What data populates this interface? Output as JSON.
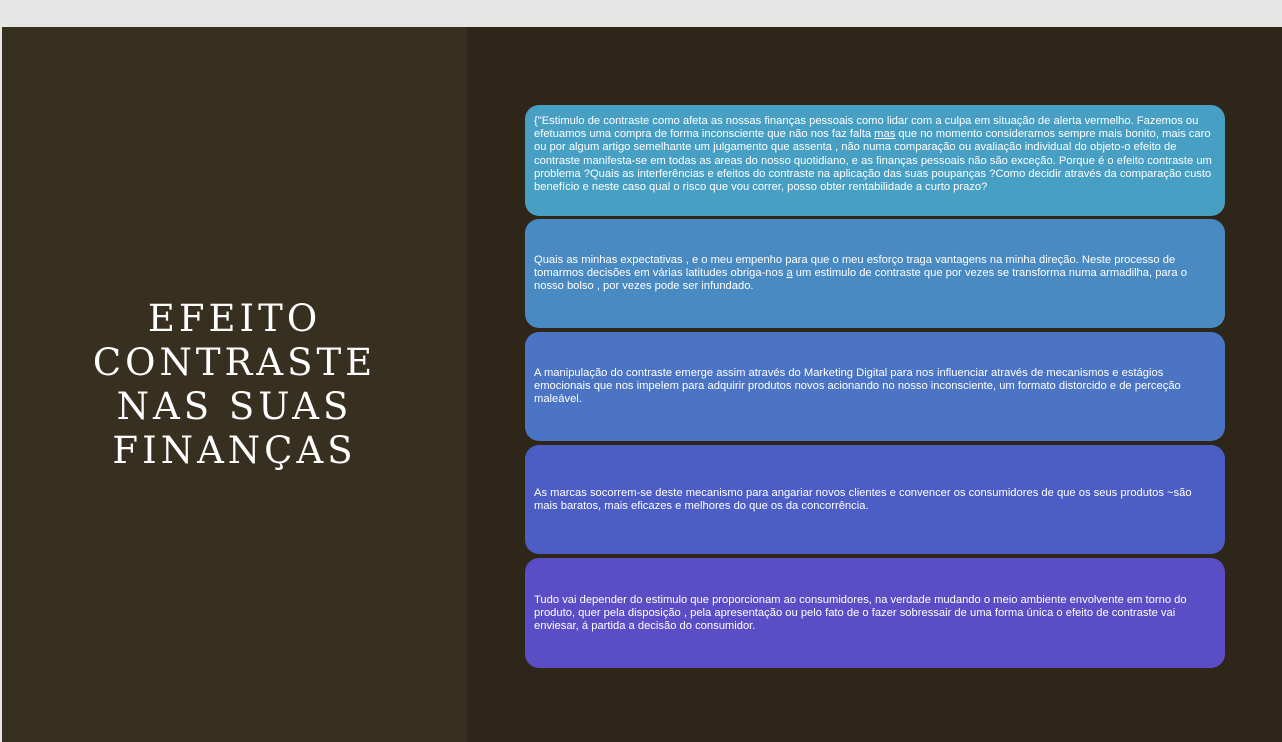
{
  "slide": {
    "title_lines": [
      "EFEITO",
      "CONTRASTE",
      "NAS SUAS",
      "FINANÇAS"
    ],
    "cards": [
      {
        "text_pre": "{\"Estimulo de contraste como  afeta  as nossas finanças pessoais como lidar com a culpa em situação de alerta vermelho. Fazemos ou efetuamos uma compra de forma inconsciente que não nos faz falta ",
        "text_underlined": "mas",
        "text_post": " que no momento consideramos sempre mais bonito, mais caro ou  por algum artigo semelhante um julgamento que assenta ,  não numa comparação ou avaliação individual do objeto-o efeito de contraste manifesta-se  em todas as areas do nosso quotidiano, e as finanças pessoais  não  são exceção. Porque é o efeito contraste um problema ?Quais as interferências e efeitos  do contraste  na aplicação das suas poupanças ?Como decidir através da comparação custo benefício e neste caso qual o risco que vou correr, posso obter rentabilidade a curto prazo?"
      },
      {
        "text_pre": "Quais as minhas expectativas , e o meu empenho para que o meu esforço traga vantagens na minha direção. Neste processo de tomarmos decisões em várias latitudes obriga-nos ",
        "text_underlined": "a",
        "text_post": " um estimulo de contraste que por vezes se transforma numa armadilha, para o nosso bolso , por vezes pode ser infundado."
      },
      {
        "text": "A manipulação do contraste emerge assim através do Marketing Digital para nos influenciar através de mecanismos e estágios emocionais que nos impelem para adquirir  produtos novos  acionando no nosso inconsciente, um formato distorcido e de perceção maleável."
      },
      {
        "text": "As marcas socorrem-se  deste mecanismo para angariar novos clientes e convencer os consumidores de que os seus produtos ~são mais baratos, mais eficazes e melhores do que os da concorrência."
      },
      {
        "text": "Tudo vai depender do estimulo que proporcionam ao consumidores, na verdade mudando o meio ambiente envolvente em torno do produto, quer pela disposição , pela apresentação ou pelo fato de o  fazer sobressair de uma forma única o efeito de contraste vai enviesar, á partida a decisão do consumidor."
      }
    ]
  },
  "colors": {
    "slide_bg": "#2e2719",
    "left_panel_bg": "#372f1f",
    "card_1": "#489fc4",
    "card_2": "#4a8ac2",
    "card_3": "#4b74c4",
    "card_4": "#4c5dc6",
    "card_5": "#5a4dc6"
  }
}
